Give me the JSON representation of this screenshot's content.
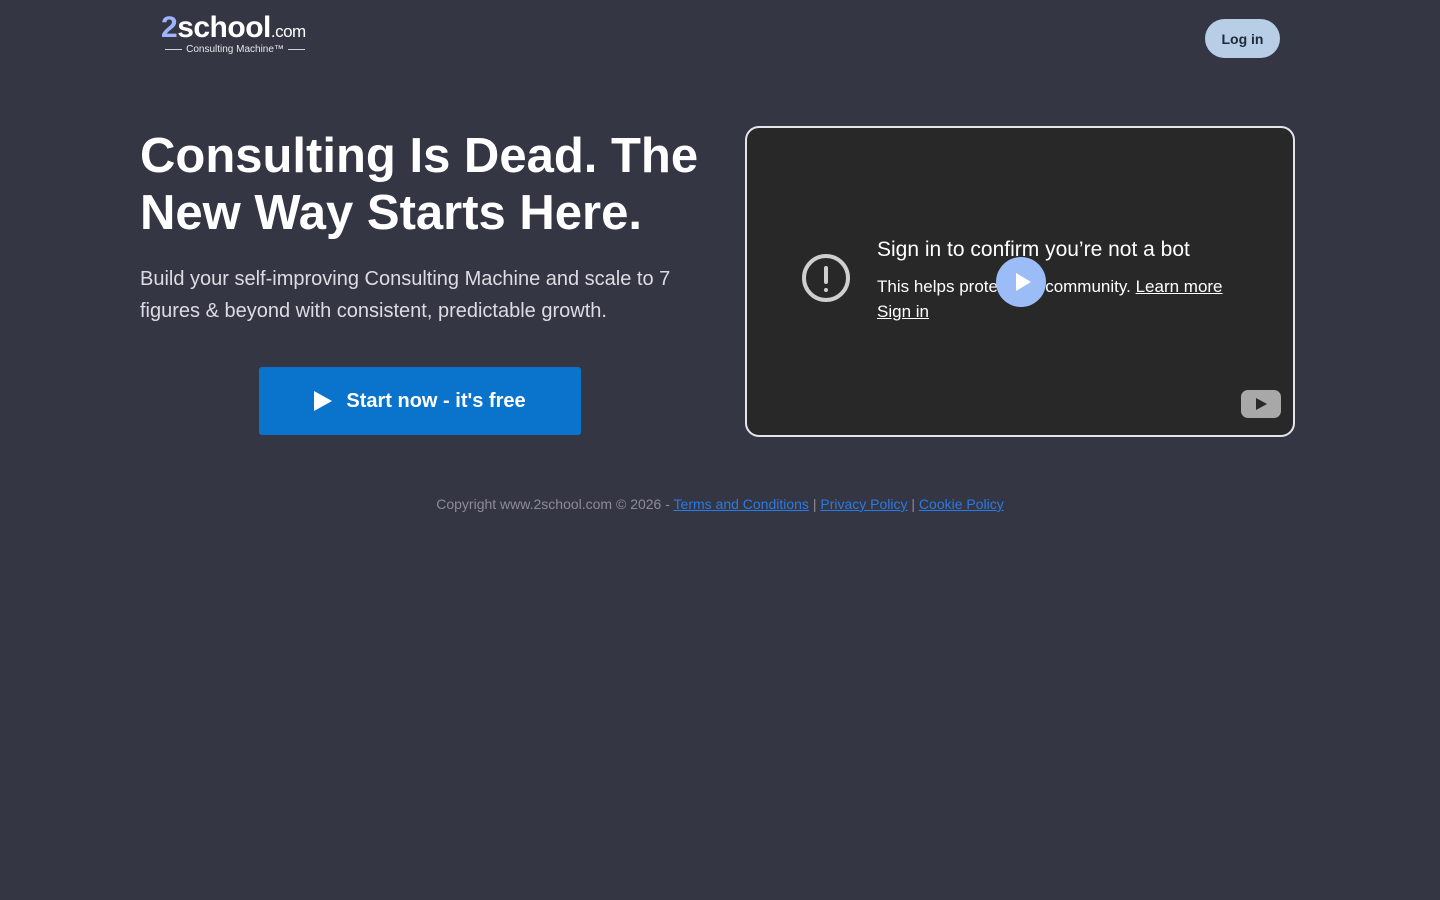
{
  "header": {
    "logo": {
      "digit": "2",
      "word": "school",
      "tld": ".com",
      "tagline": "Consulting Machine™"
    },
    "login_label": "Log in"
  },
  "hero": {
    "title": "Consulting Is Dead. The New Way Starts Here.",
    "subtitle": "Build your self-improving Consulting Machine and scale to 7 figures & beyond with consistent, predictable growth.",
    "cta_label": "Start now - it's free"
  },
  "video": {
    "title": "Sign in to confirm you’re not a bot",
    "body_prefix": "This helps protect our community.",
    "learn_more": "Learn more",
    "sign_in": "Sign in",
    "icons": {
      "alert": "alert-circle-icon",
      "play": "play-icon",
      "youtube": "youtube-logo-icon"
    }
  },
  "footer": {
    "copyright": "Copyright www.2school.com © 2026 - ",
    "links": {
      "terms": "Terms and Conditions",
      "privacy": "Privacy Policy",
      "cookie": "Cookie Policy"
    },
    "separator": " | "
  },
  "colors": {
    "background": "#353644",
    "cta": "#0a74cc",
    "login_button": "#b8cde6",
    "link": "#2a7ae4",
    "play_overlay": "#9cbcf8"
  }
}
